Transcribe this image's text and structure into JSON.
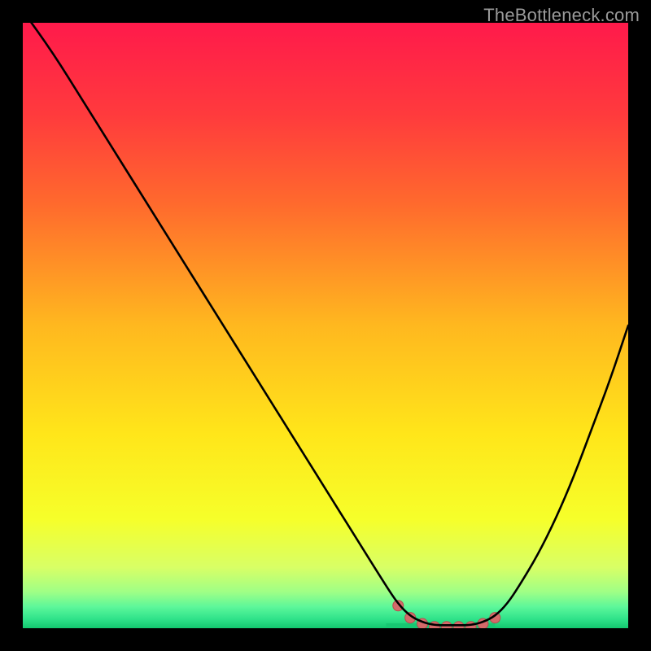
{
  "watermark": {
    "text": "TheBottleneck.com"
  },
  "chart_data": {
    "type": "line",
    "title": "",
    "xlabel": "",
    "ylabel": "",
    "xlim": [
      0,
      100
    ],
    "ylim": [
      0,
      100
    ],
    "series": [
      {
        "name": "bottleneck-curve",
        "x": [
          0,
          5,
          10,
          15,
          20,
          25,
          30,
          35,
          40,
          45,
          50,
          55,
          60,
          62,
          64,
          66,
          68,
          70,
          72,
          74,
          76,
          78,
          80,
          82,
          85,
          88,
          91,
          94,
          97,
          100
        ],
        "values": [
          102,
          95,
          87,
          79,
          71,
          63,
          55,
          47,
          39,
          31,
          23,
          15,
          7,
          4,
          2,
          1,
          0.5,
          0.5,
          0.5,
          0.5,
          1,
          2,
          4,
          7,
          12,
          18,
          25,
          33,
          41,
          50
        ]
      }
    ],
    "bottom_band_x": [
      60,
      78
    ],
    "bottom_markers_x": [
      62,
      64,
      66,
      68,
      70,
      72,
      74,
      76,
      78
    ],
    "gradient_stops": [
      {
        "offset": 0.0,
        "color": "#ff1a4b"
      },
      {
        "offset": 0.15,
        "color": "#ff3a3d"
      },
      {
        "offset": 0.3,
        "color": "#ff6a2d"
      },
      {
        "offset": 0.5,
        "color": "#ffb81f"
      },
      {
        "offset": 0.68,
        "color": "#ffe61a"
      },
      {
        "offset": 0.82,
        "color": "#f6ff2a"
      },
      {
        "offset": 0.9,
        "color": "#d8ff66"
      },
      {
        "offset": 0.94,
        "color": "#9fff86"
      },
      {
        "offset": 0.965,
        "color": "#5cf79a"
      },
      {
        "offset": 0.985,
        "color": "#2fe28a"
      },
      {
        "offset": 1.0,
        "color": "#13c86f"
      }
    ],
    "colors": {
      "curve": "#000000",
      "marker_fill": "#d46a6a",
      "marker_stroke": "#b64f4f",
      "bottom_band": "#17c772"
    }
  }
}
